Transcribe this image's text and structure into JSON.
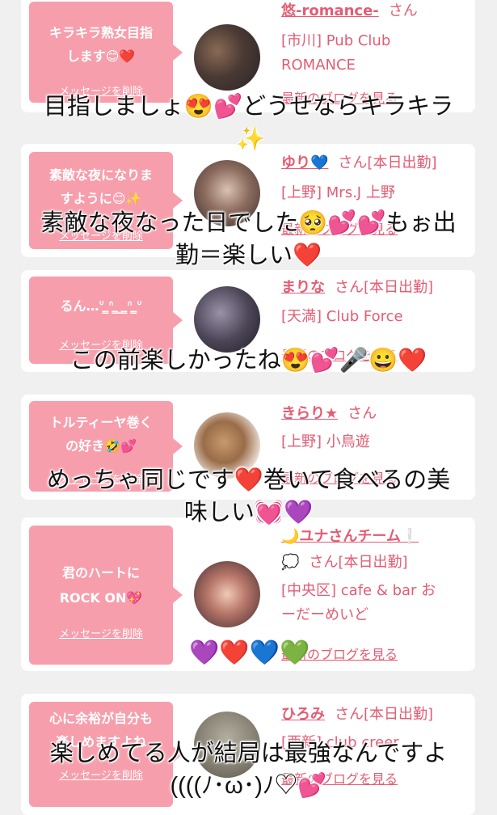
{
  "delete_label": "メッセージを削除",
  "blog_label": "最新のブログを見る",
  "san": "さん",
  "cards": [
    {
      "message_line1": "キラキラ熟女目指",
      "message_line2": "します😊❤️",
      "name": "悠-romance-",
      "status": "",
      "shop_line1": "[市川] Pub Club",
      "shop_line2": "ROMANCE"
    },
    {
      "message_line1": "素敵な夜になりま",
      "message_line2": "すように😊✨",
      "name": "ゆり💙",
      "status": "[本日出勤]",
      "shop_line1": "[上野] Mrs.J 上野",
      "shop_line2": ""
    },
    {
      "message_line1": "るん…ᐡ ̳ᐢ ̳‎ ̫ ̳ᐢ ̳ᐡ",
      "message_line2": "",
      "name": "まりな",
      "status": "[本日出勤]",
      "shop_line1": "[天満] Club Force",
      "shop_line2": ""
    },
    {
      "message_line1": "トルティーヤ巻く",
      "message_line2": "の好き🤣💕",
      "name": "きらり★",
      "status": "",
      "shop_line1": "[上野] 小鳥遊",
      "shop_line2": ""
    },
    {
      "message_line1": "君のハートに",
      "message_line2": "ROCK ON💖",
      "name": "🌙ユナさんチーム❕",
      "name_line2": "💭",
      "status": "[本日出勤]",
      "shop_line1": "[中央区] cafe & bar お",
      "shop_line2": "ーだーめいど"
    },
    {
      "message_line1": "心に余裕が自分も",
      "message_line2": "楽しめますよね",
      "name": "ひろみ",
      "status": "[本日出勤]",
      "shop_line1": "[西新] club creer",
      "shop_line2": ""
    }
  ],
  "overlays": {
    "c1_line1": "目指しましょ😍💕どうせならキラキラ",
    "c1_line2": "✨",
    "c2_line1": "素敵な夜なった日でした🥺💕💕もぉ出",
    "c2_line2": "勤＝楽しい❤️",
    "c3_line1": "この前楽しかったね😍💕🎤😀❤️",
    "c4_line1": "めっちゃ同じです❤️巻いて食べるの美",
    "c4_line2": "味しい💓💜",
    "c5_emojis": "💜❤️💙💚",
    "c6_line1": "楽しめてる人が結局は最強なんですよ",
    "c6_line2": "((((ﾉ･ω･)ﾉ♡💕"
  },
  "colors": {
    "accent": "#e45c73",
    "bubble": "#f79eac",
    "background": "#f0f0f0"
  }
}
